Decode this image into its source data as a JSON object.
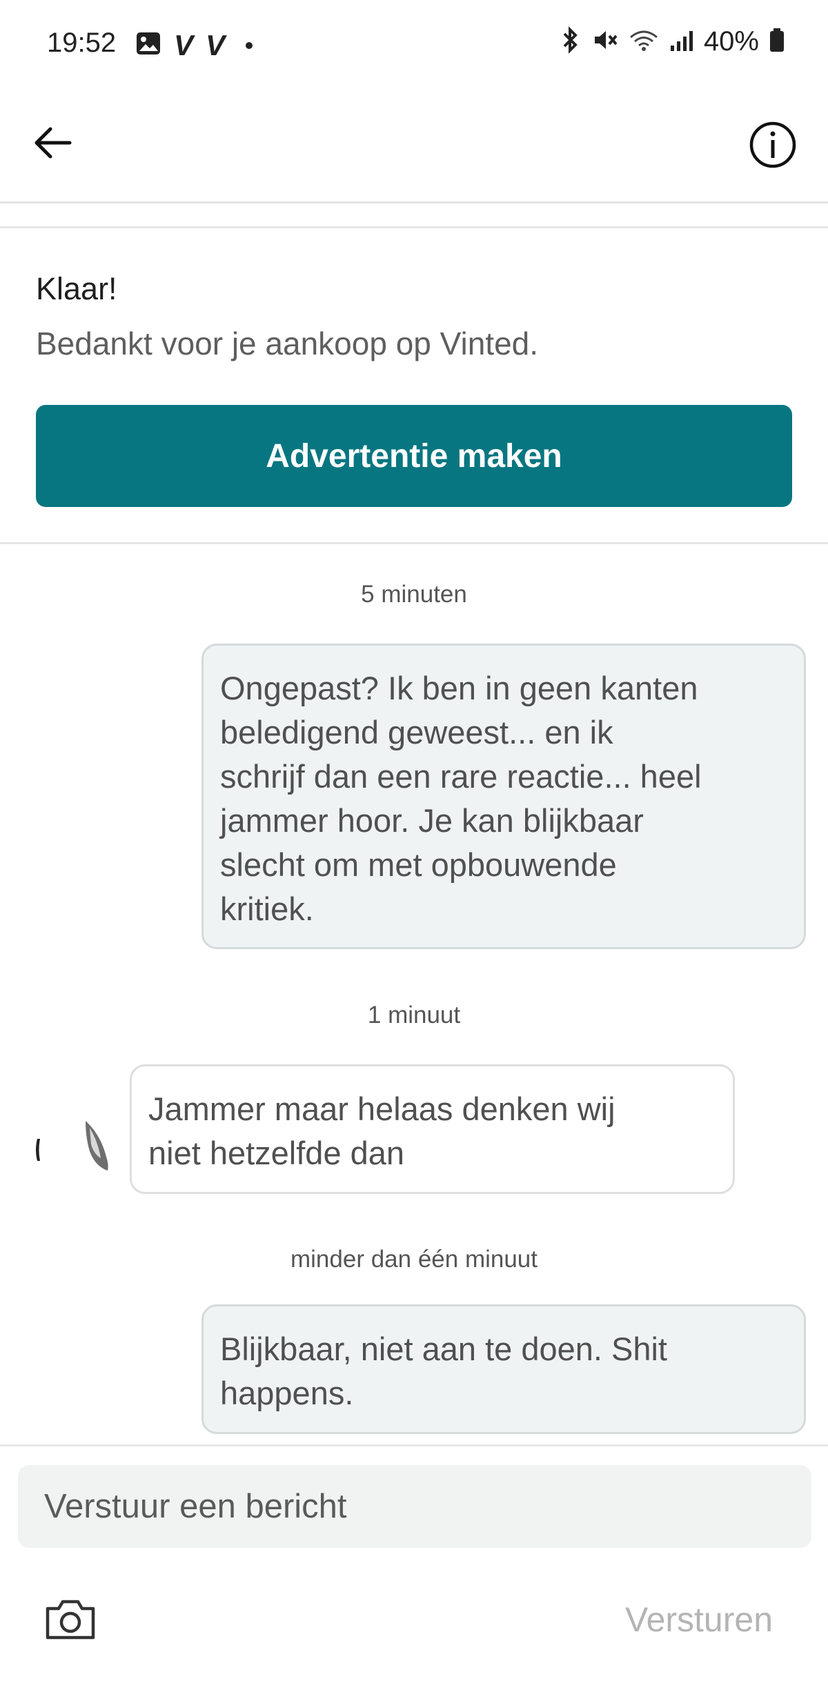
{
  "status_bar": {
    "time": "19:52",
    "left_icons": [
      "image-icon",
      "vinted-v-icon",
      "vinted-v-icon",
      "dot-icon"
    ],
    "v1": "V",
    "v2": "V",
    "right_icons": [
      "bluetooth-icon",
      "mute-icon",
      "wifi-icon",
      "signal-icon",
      "battery-icon"
    ],
    "battery": "40%"
  },
  "header": {
    "back_icon": "arrow-left-icon",
    "info_icon": "info-circle-icon"
  },
  "done_card": {
    "title": "Klaar!",
    "text": "Bedankt voor je aankoop op Vinted.",
    "button_label": "Advertentie maken",
    "button_color": "#087681"
  },
  "messages": [
    {
      "timestamp": "5 minuten",
      "direction": "outgoing",
      "lines": [
        "Ongepast? Ik ben in geen kanten",
        "beledigend geweest... en ik",
        "schrijf dan een rare reactie... heel",
        "jammer hoor. Je kan blijkbaar",
        "slecht om met opbouwende",
        "kritiek."
      ]
    },
    {
      "timestamp": "1 minuut",
      "direction": "incoming",
      "lines": [
        "Jammer maar helaas denken wij",
        "niet hetzelfde dan"
      ]
    },
    {
      "timestamp": "minder dan één minuut",
      "direction": "outgoing",
      "lines": [
        "Blijkbaar, niet aan te doen. Shit",
        "happens."
      ]
    }
  ],
  "composer": {
    "placeholder": "Verstuur een bericht",
    "camera_icon": "camera-icon",
    "send_label": "Versturen"
  }
}
